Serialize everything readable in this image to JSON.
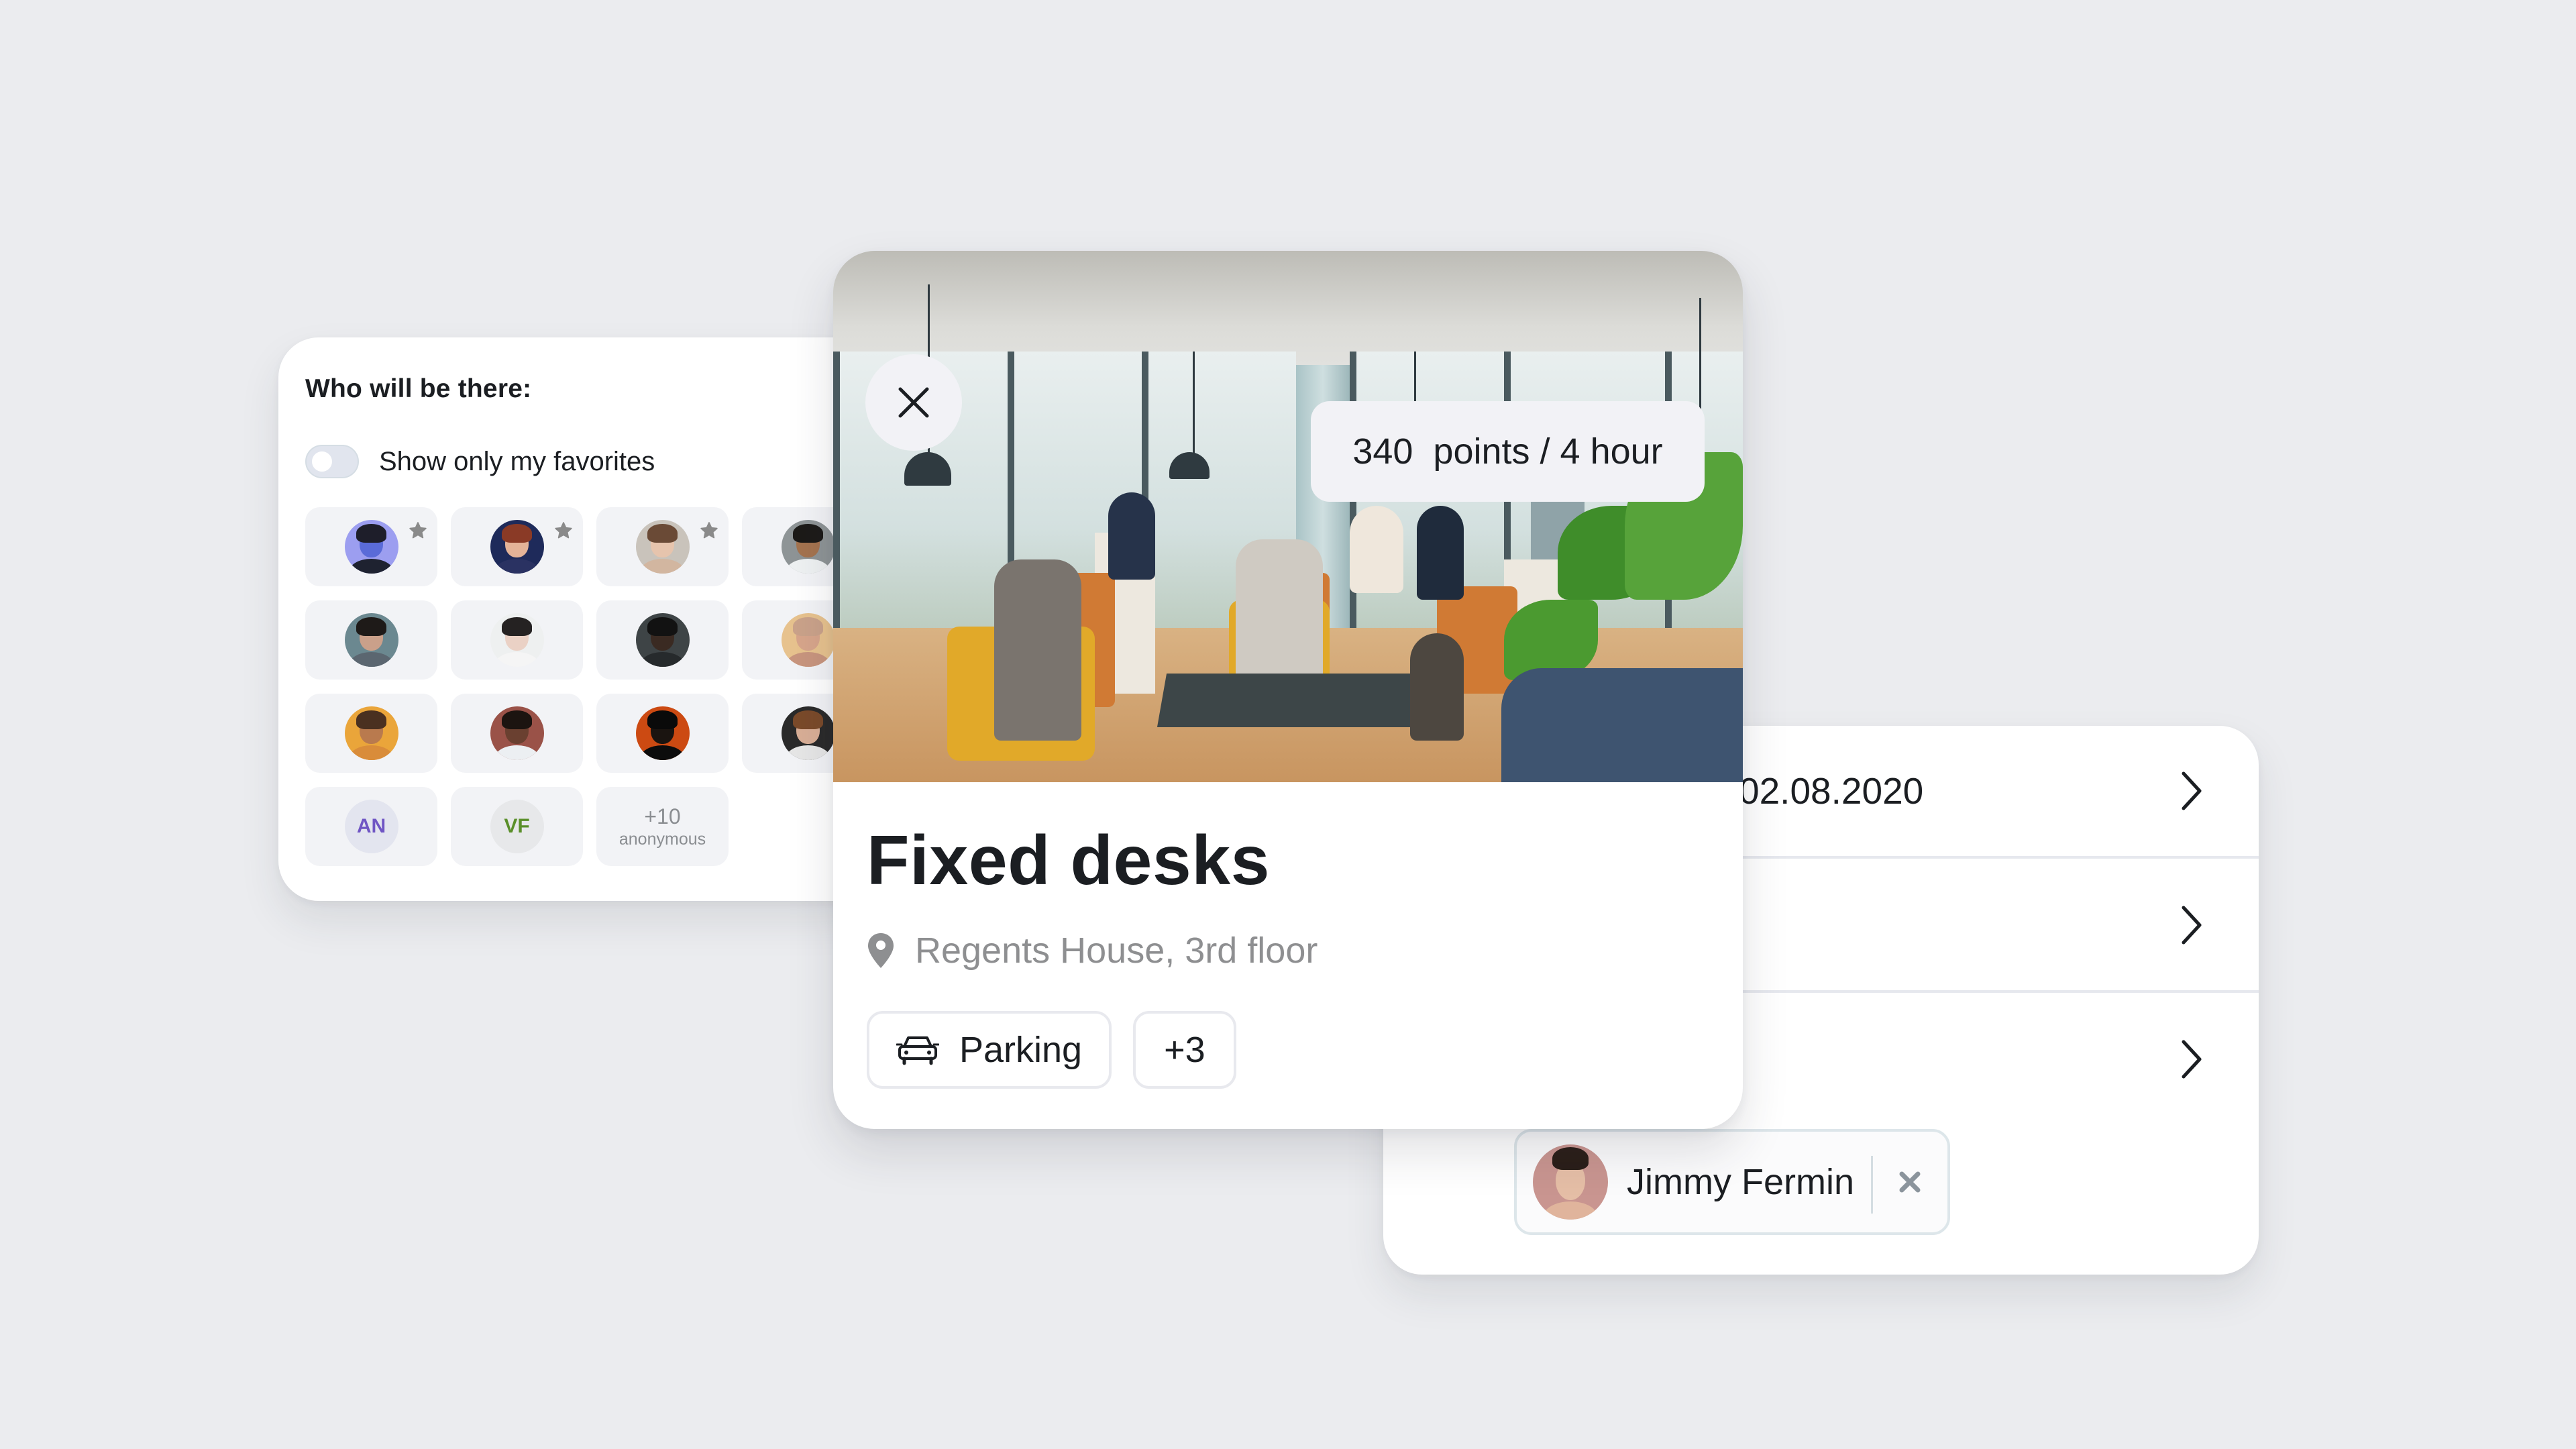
{
  "attendees": {
    "title": "Who will be there:",
    "favorites_toggle": {
      "label": "Show only my favorites",
      "on": false
    },
    "people": [
      {
        "type": "photo",
        "favorite": true,
        "colors": {
          "bg": "#9c9ef0",
          "hair": "#1e1e2a",
          "skin": "#5a6bd8",
          "shirt": "#1e2230"
        }
      },
      {
        "type": "photo",
        "favorite": true,
        "colors": {
          "bg": "#1e2a5a",
          "hair": "#8a3a26",
          "skin": "#e4b398",
          "shirt": "#2a3262"
        }
      },
      {
        "type": "photo",
        "favorite": true,
        "colors": {
          "bg": "#c9c3bb",
          "hair": "#6a4a36",
          "skin": "#e6c4ad",
          "shirt": "#d2b6a0"
        }
      },
      {
        "type": "photo",
        "favorite": false,
        "colors": {
          "bg": "#8e9496",
          "hair": "#1c1a18",
          "skin": "#a4734f",
          "shirt": "#eef1f2"
        }
      },
      {
        "type": "photo",
        "favorite": false,
        "colors": {
          "bg": "#6b8890",
          "hair": "#1e1a18",
          "skin": "#caa08a",
          "shirt": "#5b6670"
        }
      },
      {
        "type": "photo",
        "favorite": false,
        "colors": {
          "bg": "#eef0f0",
          "hair": "#252222",
          "skin": "#ead1c5",
          "shirt": "#f5f5f5"
        }
      },
      {
        "type": "photo",
        "favorite": false,
        "colors": {
          "bg": "#3e4446",
          "hair": "#121212",
          "skin": "#3a2a22",
          "shirt": "#262a2c"
        }
      },
      {
        "type": "photo",
        "favorite": false,
        "colors": {
          "bg": "#e7c28e",
          "hair": "#caa28a",
          "skin": "#d7a58b",
          "shirt": "#c8957e"
        }
      },
      {
        "type": "photo",
        "favorite": false,
        "colors": {
          "bg": "#eaa53a",
          "hair": "#4a3020",
          "skin": "#b97a4e",
          "shirt": "#d98c3a"
        }
      },
      {
        "type": "photo",
        "favorite": false,
        "colors": {
          "bg": "#9a5248",
          "hair": "#1c1410",
          "skin": "#6a4030",
          "shirt": "#eceff2"
        }
      },
      {
        "type": "photo",
        "favorite": false,
        "colors": {
          "bg": "#cc4a12",
          "hair": "#0a0a0a",
          "skin": "#1a1410",
          "shirt": "#0c0c0c"
        }
      },
      {
        "type": "photo",
        "favorite": false,
        "colors": {
          "bg": "#2a2a2a",
          "hair": "#7a4a2a",
          "skin": "#d8ae96",
          "shirt": "#e6e6e6"
        }
      },
      {
        "type": "initials",
        "text": "AN",
        "bg": "#e3e5ef",
        "fg": "#6f55c4"
      },
      {
        "type": "initials",
        "text": "VF",
        "bg": "#e7e8ea",
        "fg": "#5a8f2a"
      },
      {
        "type": "anonymous",
        "count": "+10",
        "label": "anonymous"
      }
    ]
  },
  "space": {
    "close_icon": "close-icon",
    "price": "340  points / 4 hour",
    "title": "Fixed desks",
    "location": "Regents House, 3rd floor",
    "location_icon": "map-pin-icon",
    "amenities": [
      {
        "icon": "car-icon",
        "label": "Parking"
      }
    ],
    "more_amenities": "+3"
  },
  "booking": {
    "rows": [
      {
        "value": "02.08.2020",
        "icon": "chevron-right-icon"
      },
      {
        "value": "",
        "icon": "chevron-right-icon"
      },
      {
        "value": "",
        "icon": "chevron-right-icon"
      }
    ],
    "selected_attendee": {
      "name": "Jimmy Fermin",
      "remove_icon": "close-icon",
      "avatar_bg": "#c99590"
    }
  },
  "colors": {
    "background": "#ebecef",
    "card": "#ffffff",
    "tile": "#f2f3f6",
    "text_primary": "#1b1e22",
    "text_secondary": "#8e8f91",
    "star": "#8a8a8a"
  }
}
